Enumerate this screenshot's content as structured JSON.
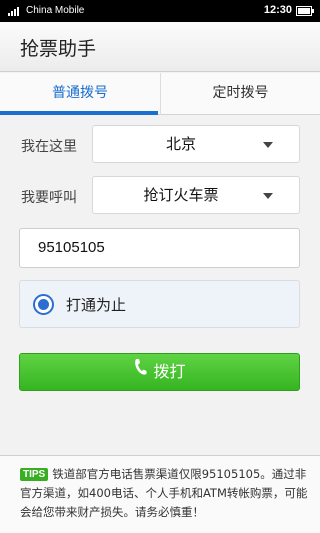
{
  "status_bar": {
    "carrier": "China Mobile",
    "time": "12:30"
  },
  "app": {
    "title": "抢票助手"
  },
  "tabs": [
    {
      "label": "普通拨号",
      "active": true
    },
    {
      "label": "定时拨号",
      "active": false
    }
  ],
  "form": {
    "location_label": "我在这里",
    "location_value": "北京",
    "call_label": "我要呼叫",
    "call_value": "抢订火车票",
    "phone_number": "95105105",
    "redial_option": "打通为止",
    "redial_checked": true,
    "dial_button": "拨打"
  },
  "tips": {
    "badge": "TIPS",
    "text": "铁道部官方电话售票渠道仅限95105105。通过非官方渠道，如400电话、个人手机和ATM转帐购票，可能会给您带来财产损失。请务必慎重！"
  },
  "colors": {
    "accent": "#1a6fcf",
    "dial_green": "#3cba26",
    "tips_green": "#3aae23"
  }
}
